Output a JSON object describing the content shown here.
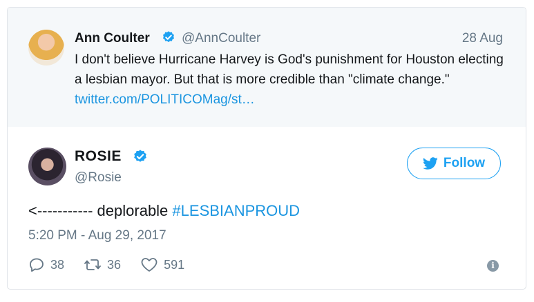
{
  "quoted_tweet": {
    "name": "Ann Coulter",
    "handle": "@AnnCoulter",
    "date": "28 Aug",
    "text": "I don't believe Hurricane Harvey is God's punishment for Houston electing a lesbian mayor. But that is more credible than \"climate change.\" ",
    "link": "twitter.com/POLITICOMag/st…",
    "avatar_icon": "ann-coulter-avatar"
  },
  "tweet": {
    "name": "ROSIE",
    "handle": "@Rosie",
    "follow_label": "Follow",
    "text_prefix": "<----------- deplorable ",
    "hashtag": "#LESBIANPROUD",
    "timestamp": "5:20 PM - Aug 29, 2017",
    "avatar_icon": "rosie-avatar"
  },
  "actions": {
    "replies": "38",
    "retweets": "36",
    "likes": "591"
  },
  "colors": {
    "accent": "#1da1f2",
    "link": "#1b95e0",
    "muted": "#657786",
    "quoted_bg": "#f5f8fa"
  }
}
